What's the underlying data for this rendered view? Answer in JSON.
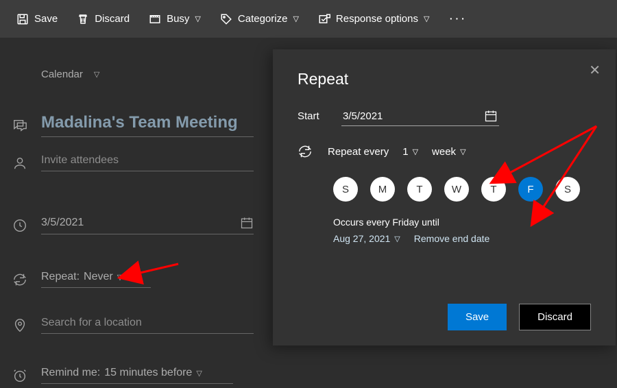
{
  "toolbar": {
    "save": "Save",
    "discard": "Discard",
    "busy": "Busy",
    "categorize": "Categorize",
    "response": "Response options"
  },
  "crumb": "Calendar",
  "form": {
    "title": "Madalina's Team Meeting",
    "attendees_placeholder": "Invite attendees",
    "date": "3/5/2021",
    "repeat_label": "Repeat:",
    "repeat_value": "Never",
    "location_placeholder": "Search for a location",
    "remind_label": "Remind me:",
    "remind_value": "15 minutes before"
  },
  "dialog": {
    "title": "Repeat",
    "start_label": "Start",
    "start_value": "3/5/2021",
    "repeat_every_label": "Repeat every",
    "interval": "1",
    "unit": "week",
    "days": [
      "S",
      "M",
      "T",
      "W",
      "T",
      "F",
      "S"
    ],
    "selected_index": 5,
    "occurs_text": "Occurs every Friday until",
    "until": "Aug 27, 2021",
    "remove_end": "Remove end date",
    "save": "Save",
    "discard": "Discard"
  }
}
